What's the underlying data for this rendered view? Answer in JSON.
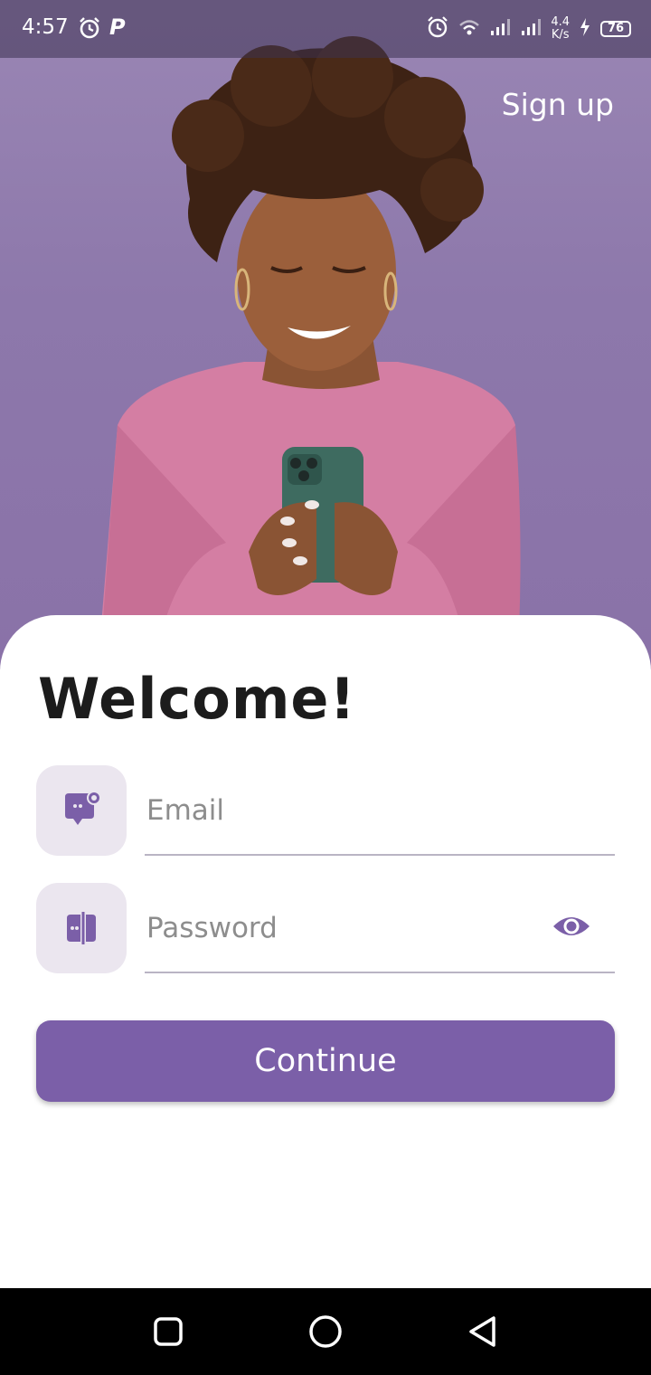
{
  "status_bar": {
    "time": "4:57",
    "net_speed_value": "4.4",
    "net_speed_unit": "K/s",
    "battery": "76",
    "icons": [
      "alarm-icon",
      "p-app-icon",
      "alarm-icon",
      "wifi-icon",
      "signal-icon",
      "signal-icon",
      "charging-icon",
      "battery-icon"
    ],
    "p_icon_label": "P"
  },
  "header": {
    "signup_label": "Sign up"
  },
  "login": {
    "title": "Welcome!",
    "email": {
      "placeholder": "Email",
      "value": "",
      "icon": "email-chat-icon"
    },
    "password": {
      "placeholder": "Password",
      "value": "",
      "icon": "password-lock-icon",
      "toggle_icon": "eye-icon"
    },
    "continue_label": "Continue"
  },
  "nav_bar": {
    "icons": [
      "recents-icon",
      "home-icon",
      "back-icon"
    ]
  },
  "colors": {
    "accent": "#7b5fa8",
    "icon_bg": "#ebe6ef",
    "hero_bg": "#9a86b4"
  }
}
